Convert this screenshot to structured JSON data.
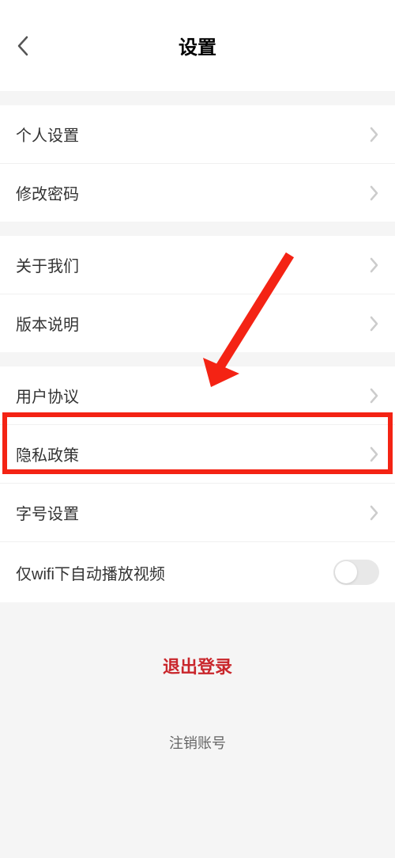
{
  "header": {
    "title": "设置"
  },
  "groups": [
    {
      "items": [
        {
          "key": "profile",
          "label": "个人设置",
          "type": "chevron"
        },
        {
          "key": "password",
          "label": "修改密码",
          "type": "chevron"
        }
      ]
    },
    {
      "items": [
        {
          "key": "about",
          "label": "关于我们",
          "type": "chevron"
        },
        {
          "key": "version",
          "label": "版本说明",
          "type": "chevron"
        }
      ]
    },
    {
      "items": [
        {
          "key": "user-agreement",
          "label": "用户协议",
          "type": "chevron"
        },
        {
          "key": "privacy-policy",
          "label": "隐私政策",
          "type": "chevron"
        },
        {
          "key": "font-size",
          "label": "字号设置",
          "type": "chevron"
        },
        {
          "key": "wifi-autoplay",
          "label": "仅wifi下自动播放视频",
          "type": "toggle",
          "on": false
        }
      ]
    }
  ],
  "actions": {
    "logout": "退出登录",
    "deactivate": "注销账号"
  },
  "annotation": {
    "highlight_target": "privacy-policy"
  }
}
